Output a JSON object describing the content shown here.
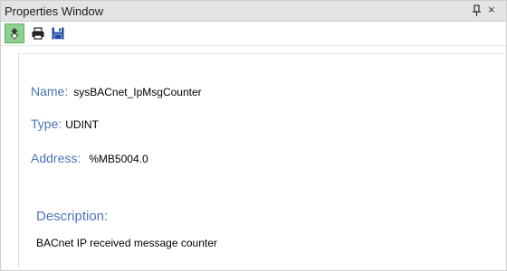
{
  "window": {
    "title": "Properties Window",
    "pin_icon": "pin-icon",
    "close_label": "×"
  },
  "toolbar": {
    "buttons": [
      {
        "icon": "navigate-icon",
        "active": true
      },
      {
        "icon": "print-icon",
        "active": false
      },
      {
        "icon": "save-icon",
        "active": false
      }
    ]
  },
  "properties": {
    "name_label": "Name:",
    "name_value": "sysBACnet_IpMsgCounter",
    "type_label": "Type:",
    "type_value": "UDINT",
    "address_label": "Address:",
    "address_value": "%MB5004.0",
    "description_label": "Description:",
    "description_value": "BACnet IP received message counter"
  },
  "colors": {
    "label": "#4a76b8",
    "active_button": "#8ed08e",
    "titlebar": "#e3e3e3",
    "save_icon": "#1f4aa8"
  }
}
